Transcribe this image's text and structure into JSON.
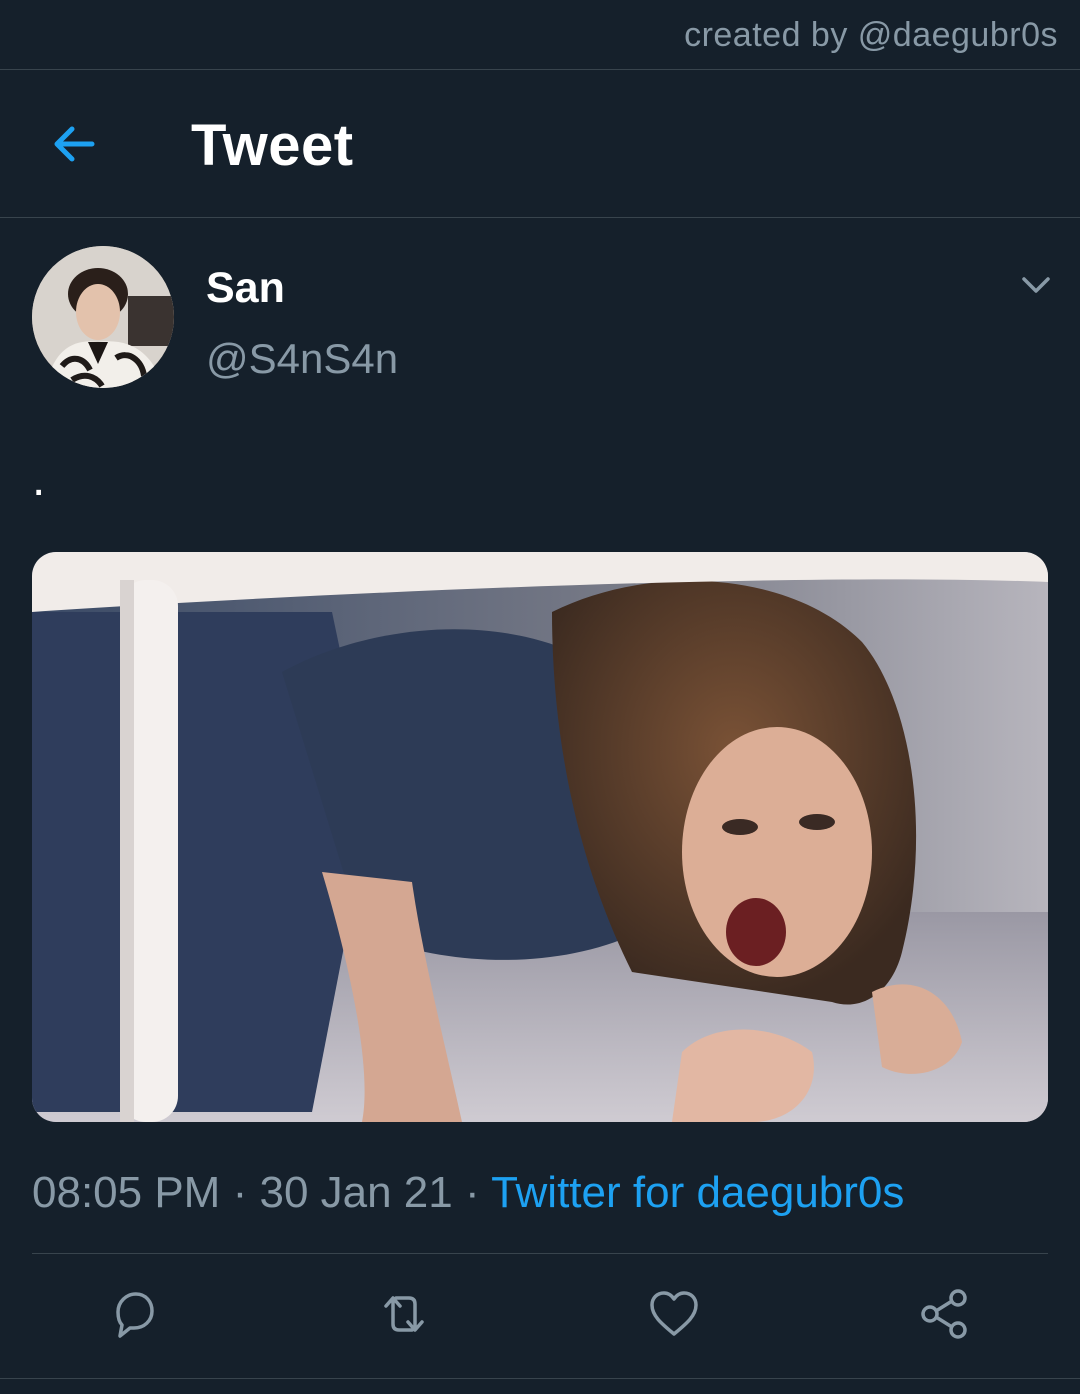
{
  "credit": "created by @daegubr0s",
  "header": {
    "back_icon": "arrow-left-icon",
    "title": "Tweet"
  },
  "tweet": {
    "author": {
      "display_name": "San",
      "handle": "@S4nS4n"
    },
    "text": ".",
    "media": {
      "kind": "photo"
    },
    "meta": {
      "time": "08:05 PM",
      "separator": "·",
      "date": "30 Jan 21",
      "source": "Twitter for daegubr0s"
    }
  },
  "actions": [
    {
      "icon": "reply-icon"
    },
    {
      "icon": "retweet-icon"
    },
    {
      "icon": "like-icon"
    },
    {
      "icon": "share-icon"
    }
  ],
  "colors": {
    "background": "#15202b",
    "divider": "#38444d",
    "secondary_text": "#8899a6",
    "accent": "#1da1f2",
    "primary_text": "#ffffff"
  }
}
